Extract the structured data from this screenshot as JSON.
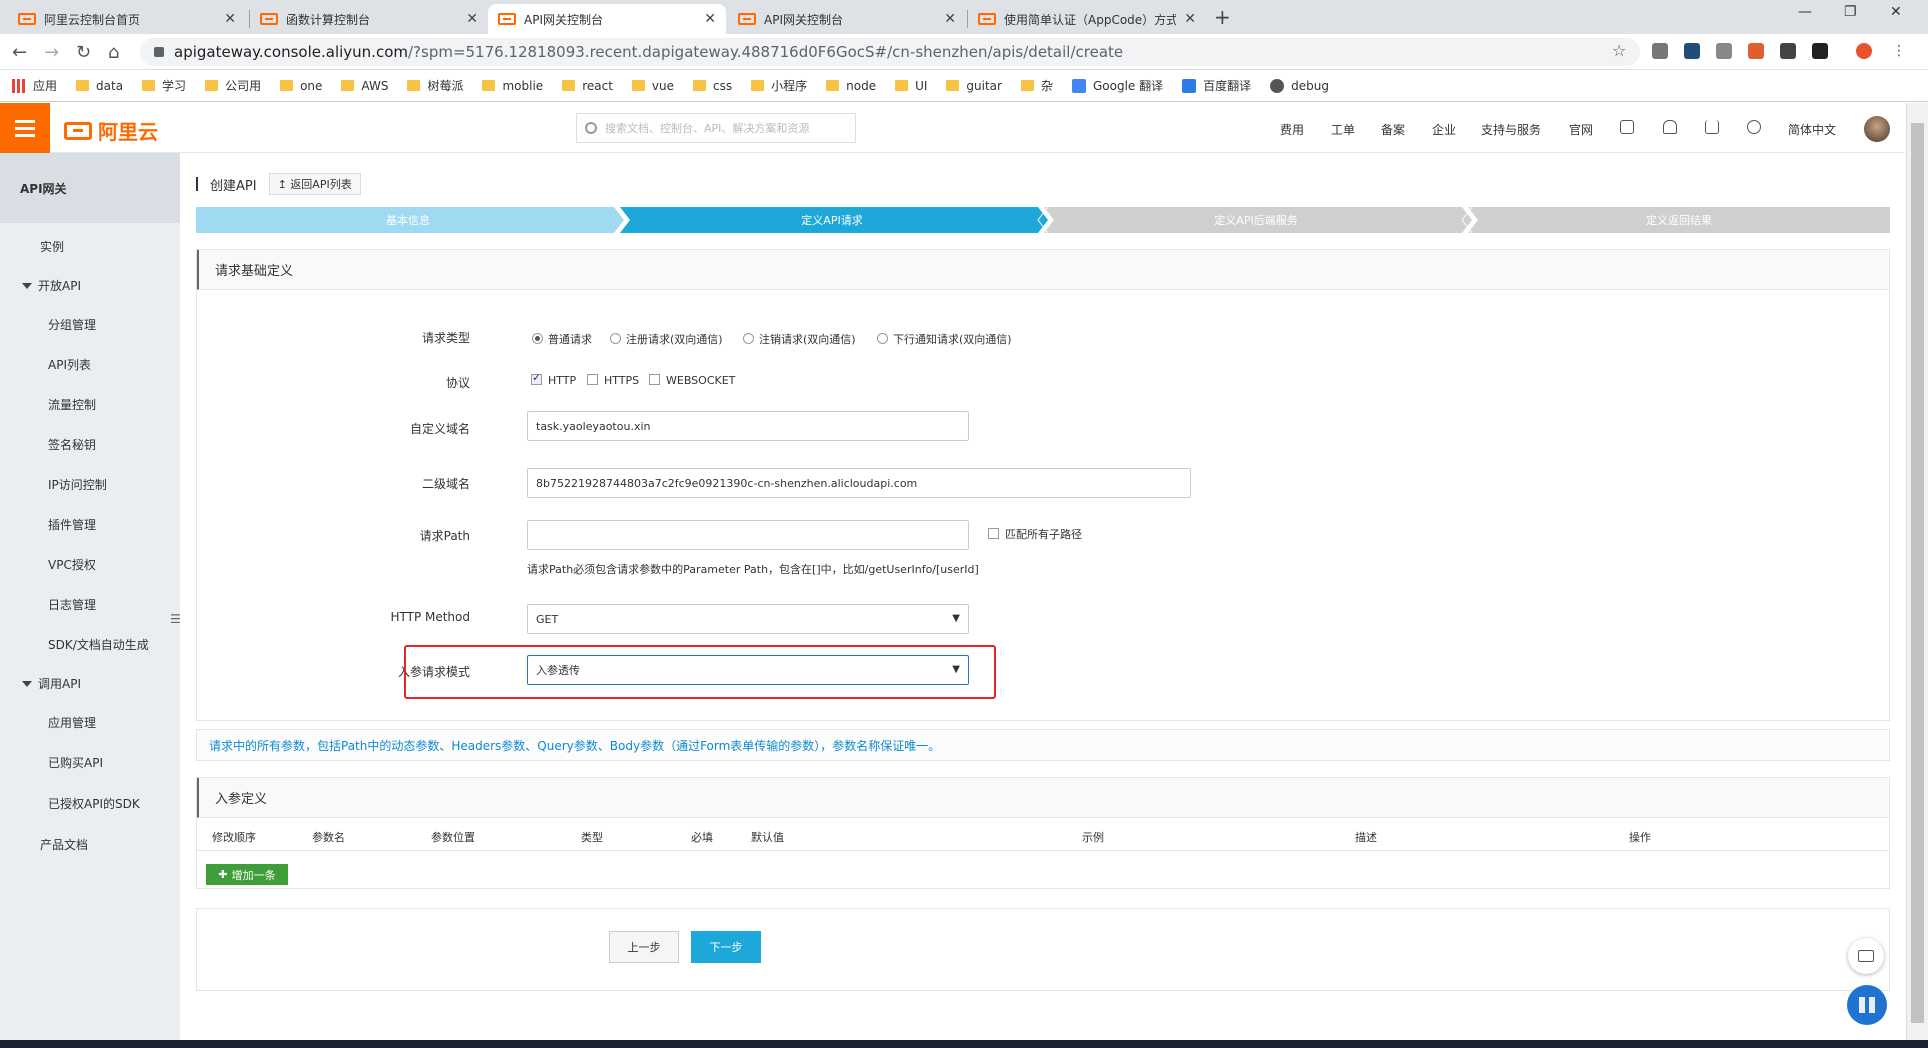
{
  "browser": {
    "tabs": [
      {
        "title": "阿里云控制台首页",
        "active": false
      },
      {
        "title": "函数计算控制台",
        "active": false
      },
      {
        "title": "API网关控制台",
        "active": true
      },
      {
        "title": "API网关控制台",
        "active": false
      },
      {
        "title": "使用简单认证（AppCode）方式",
        "active": false
      }
    ],
    "url_host": "apigateway.console.aliyun.com",
    "url_rest": "/?spm=5176.12818093.recent.dapigateway.488716d0F6GocS#/cn-shenzhen/apis/detail/create",
    "bookmarks": [
      "应用",
      "data",
      "学习",
      "公司用",
      "one",
      "AWS",
      "树莓派",
      "moblie",
      "react",
      "vue",
      "css",
      "小程序",
      "node",
      "UI",
      "guitar",
      "杂",
      "Google 翻译",
      "百度翻译",
      "debug"
    ]
  },
  "header": {
    "logo": "阿里云",
    "search_placeholder": "搜索文档、控制台、API、解决方案和资源",
    "nav": [
      "费用",
      "工单",
      "备案",
      "企业",
      "支持与服务",
      "官网"
    ],
    "lang": "简体中文"
  },
  "sidebar": {
    "title": "API网关",
    "instance": "实例",
    "group_open": "开放API",
    "open_items": [
      "分组管理",
      "API列表",
      "流量控制",
      "签名秘钥",
      "IP访问控制",
      "插件管理",
      "VPC授权",
      "日志管理",
      "SDK/文档自动生成"
    ],
    "group_call": "调用API",
    "call_items": [
      "应用管理",
      "已购买API",
      "已授权API的SDK"
    ],
    "docs": "产品文档"
  },
  "page": {
    "title": "创建API",
    "back": "返回API列表",
    "steps": [
      "基本信息",
      "定义API请求",
      "定义API后端服务",
      "定义返回结果"
    ],
    "active_step": 1
  },
  "form": {
    "section_title": "请求基础定义",
    "request_type_label": "请求类型",
    "request_types": [
      "普通请求",
      "注册请求(双向通信)",
      "注销请求(双向通信)",
      "下行通知请求(双向通信)"
    ],
    "protocol_label": "协议",
    "protocols": [
      {
        "label": "HTTP",
        "checked": true
      },
      {
        "label": "HTTPS",
        "checked": false
      },
      {
        "label": "WEBSOCKET",
        "checked": false
      }
    ],
    "custom_domain_label": "自定义域名",
    "custom_domain_value": "task.yaoleyaotou.xin",
    "sub_domain_label": "二级域名",
    "sub_domain_value": "8b75221928744803a7c2fc9e0921390c-cn-shenzhen.alicloudapi.com",
    "path_label": "请求Path",
    "path_value": "",
    "match_all_label": "匹配所有子路径",
    "path_hint": "请求Path必须包含请求参数中的Parameter Path，包含在[]中，比如/getUserInfo/[userId]",
    "method_label": "HTTP Method",
    "method_value": "GET",
    "mode_label": "入参请求模式",
    "mode_value": "入参透传"
  },
  "info_text": "请求中的所有参数，包括Path中的动态参数、Headers参数、Query参数、Body参数（通过Form表单传输的参数），参数名称保证唯一。",
  "params": {
    "section_title": "入参定义",
    "columns": [
      "修改顺序",
      "参数名",
      "参数位置",
      "类型",
      "必填",
      "默认值",
      "示例",
      "描述",
      "操作"
    ],
    "add_label": "增加一条"
  },
  "buttons": {
    "prev": "上一步",
    "next": "下一步"
  },
  "colors": {
    "accent": "#ff6a00",
    "step_done": "#9fd9f2",
    "step_active": "#1ea8d9",
    "step_todo": "#cfcfcf",
    "next_btn": "#1ea8d9",
    "add_btn": "#3f9d3a",
    "highlight": "#e4262b"
  }
}
